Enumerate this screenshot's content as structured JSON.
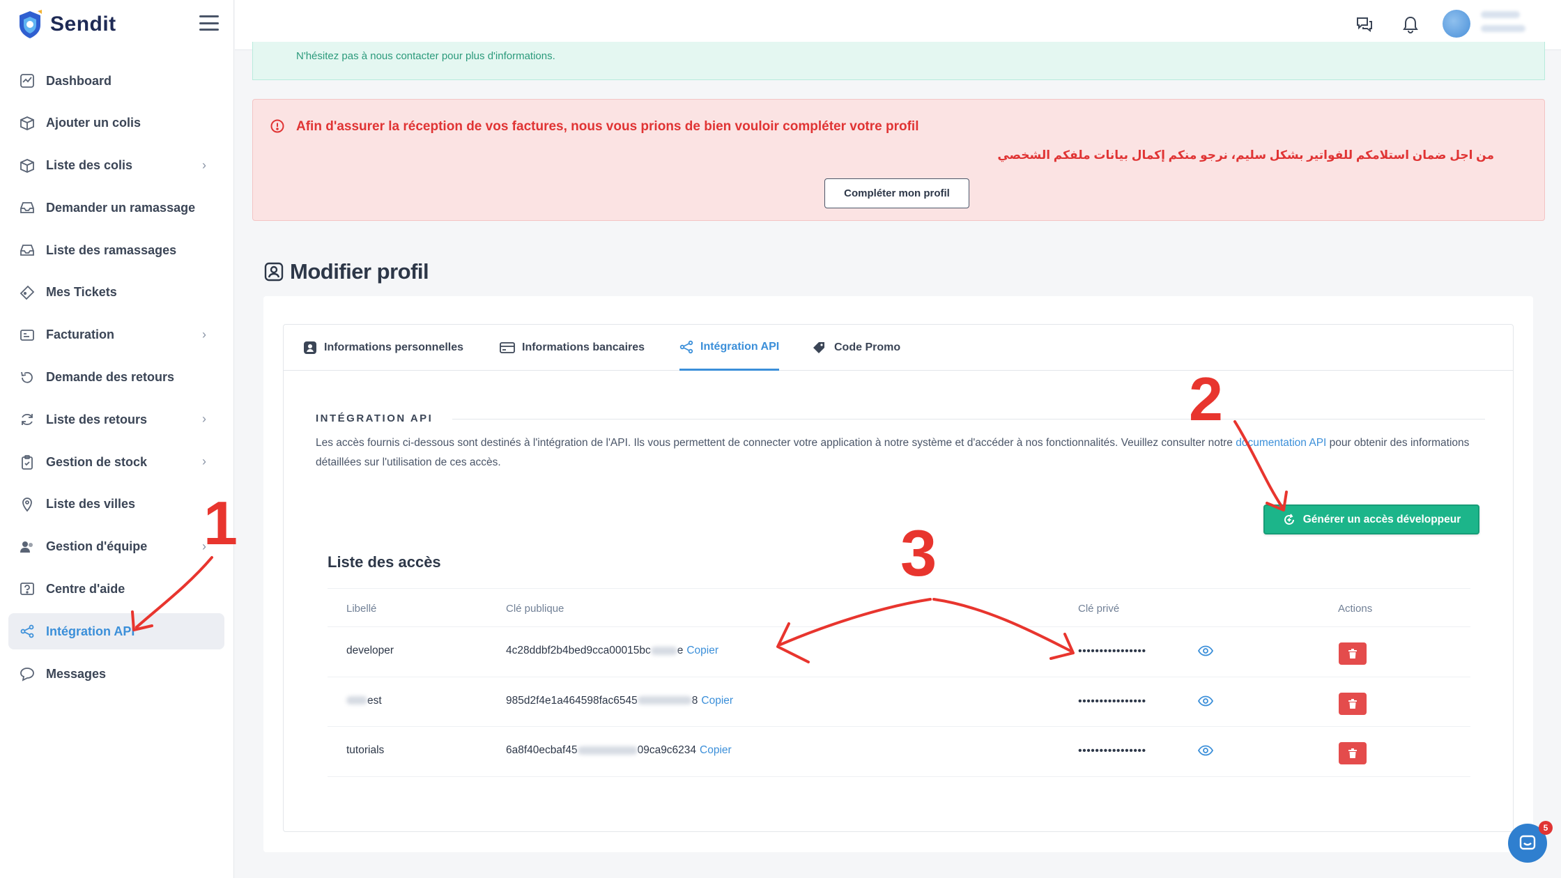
{
  "brand": {
    "name": "Sendit"
  },
  "sidebar": {
    "items": [
      {
        "label": "Dashboard",
        "icon": "dashboard-icon",
        "chevron": false,
        "active": false
      },
      {
        "label": "Ajouter un colis",
        "icon": "package-icon",
        "chevron": false,
        "active": false
      },
      {
        "label": "Liste des colis",
        "icon": "package-list-icon",
        "chevron": true,
        "active": false
      },
      {
        "label": "Demander un ramassage",
        "icon": "inbox-icon",
        "chevron": false,
        "active": false
      },
      {
        "label": "Liste des ramassages",
        "icon": "inbox-list-icon",
        "chevron": false,
        "active": false
      },
      {
        "label": "Mes Tickets",
        "icon": "ticket-icon",
        "chevron": false,
        "active": false
      },
      {
        "label": "Facturation",
        "icon": "billing-icon",
        "chevron": true,
        "active": false
      },
      {
        "label": "Demande des retours",
        "icon": "return-icon",
        "chevron": false,
        "active": false
      },
      {
        "label": "Liste des retours",
        "icon": "refresh-icon",
        "chevron": true,
        "active": false
      },
      {
        "label": "Gestion de stock",
        "icon": "clipboard-icon",
        "chevron": true,
        "active": false
      },
      {
        "label": "Liste des villes",
        "icon": "location-icon",
        "chevron": false,
        "active": false
      },
      {
        "label": "Gestion d'équipe",
        "icon": "team-icon",
        "chevron": true,
        "active": false
      },
      {
        "label": "Centre d'aide",
        "icon": "help-icon",
        "chevron": false,
        "active": false
      },
      {
        "label": "Intégration API",
        "icon": "share-icon",
        "chevron": false,
        "active": true
      },
      {
        "label": "Messages",
        "icon": "message-icon",
        "chevron": false,
        "active": false
      }
    ]
  },
  "topbar": {
    "icons": [
      "chat-icon",
      "bell-icon"
    ]
  },
  "alerts": {
    "info_text": "N'hésitez pas à nous contacter pour plus d'informations.",
    "warning_fr": "Afin d'assurer la réception de vos factures, nous vous prions de bien vouloir compléter votre profil",
    "warning_ar": "من اجل ضمان استلامكم للفواتير بشكل سليم، نرجو منكم إكمال بيانات ملفكم الشخصي",
    "complete_button": "Compléter mon profil"
  },
  "page": {
    "title": "Modifier profil"
  },
  "tabs": [
    {
      "label": "Informations personnelles",
      "icon": "user-card-icon",
      "active": false
    },
    {
      "label": "Informations bancaires",
      "icon": "credit-card-icon",
      "active": false
    },
    {
      "label": "Intégration API",
      "icon": "share-icon",
      "active": true
    },
    {
      "label": "Code Promo",
      "icon": "tag-icon",
      "active": false
    }
  ],
  "api_section": {
    "title": "INTÉGRATION API",
    "desc_before": "Les accès fournis ci-dessous sont destinés à l'intégration de l'API. Ils vous permettent de connecter votre application à notre système et d'accéder à nos fonctionnalités. Veuillez consulter notre ",
    "desc_link": "documentation API",
    "desc_after": " pour obtenir des informations détaillées sur l'utilisation de ces accès.",
    "generate_button": "Générer un accès développeur"
  },
  "access_list": {
    "title": "Liste des accès",
    "columns": [
      "Libellé",
      "Clé publique",
      "Clé privé",
      "Actions"
    ],
    "copy_label": "Copier",
    "rows": [
      {
        "label": "developer",
        "key_start": "4c28ddbf2b4bed9cca00015bc",
        "key_end": "e",
        "private": "••••••••••••••••"
      },
      {
        "label": "est",
        "key_start": "985d2f4e1a464598fac6545",
        "key_end": "8",
        "private": "••••••••••••••••"
      },
      {
        "label": "tutorials",
        "key_start": "6a8f40ecbaf45",
        "key_end": "09ca9c6234",
        "private": "••••••••••••••••"
      }
    ]
  },
  "annotations": {
    "one": "1",
    "two": "2",
    "three": "3"
  },
  "chat": {
    "badge": "5"
  },
  "colors": {
    "accent": "#3b8fd9",
    "green": "#1cb58a",
    "danger": "#e44c4c",
    "annotation": "#e8352e"
  }
}
